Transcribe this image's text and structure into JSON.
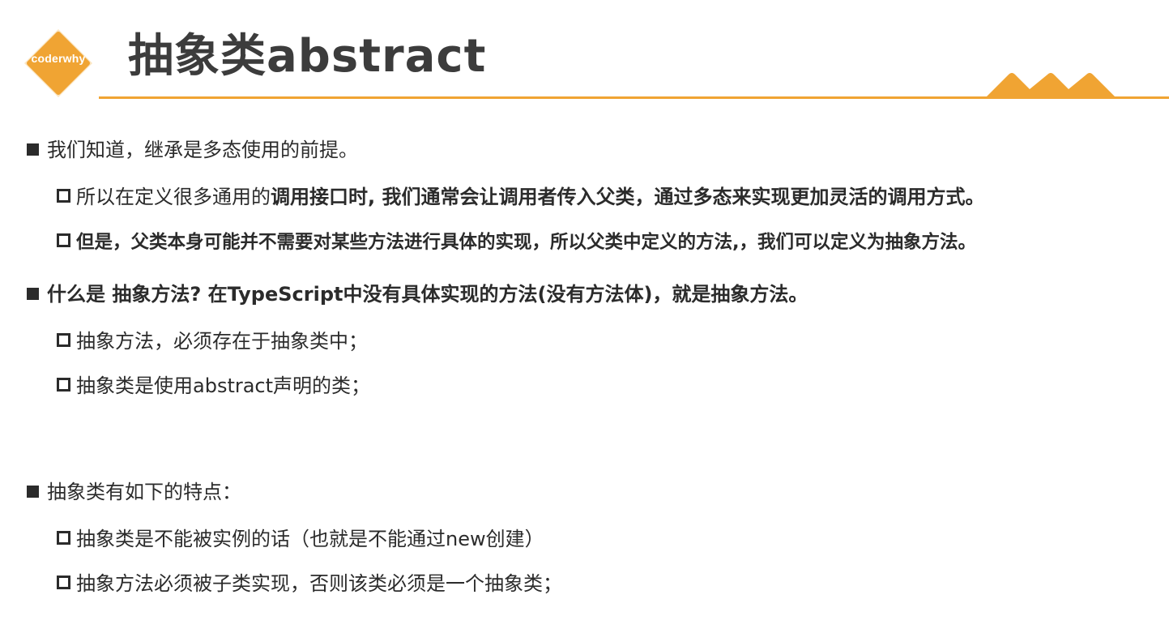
{
  "logo": {
    "text": "coderwhy",
    "color": "#f0a433"
  },
  "title": "抽象类abstract",
  "accent_color": "#f0a433",
  "bullets": {
    "b1": "我们知道，继承是多态使用的前提。",
    "b1_s1_normal": "所以在定义很多通用的",
    "b1_s1_bold": "调用接口时, 我们通常会让调用者传入父类，通过多态来实现更加灵活的调用方式。",
    "b1_s2": "但是，父类本身可能并不需要对某些方法进行具体的实现，所以父类中定义的方法,，我们可以定义为抽象方法。",
    "b2": "什么是 抽象方法? 在TypeScript中没有具体实现的方法(没有方法体)，就是抽象方法。",
    "b2_s1": "抽象方法，必须存在于抽象类中；",
    "b2_s2": "抽象类是使用abstract声明的类；",
    "b3": "抽象类有如下的特点：",
    "b3_s1": "抽象类是不能被实例的话（也就是不能通过new创建）",
    "b3_s2": "抽象方法必须被子类实现，否则该类必须是一个抽象类；"
  }
}
